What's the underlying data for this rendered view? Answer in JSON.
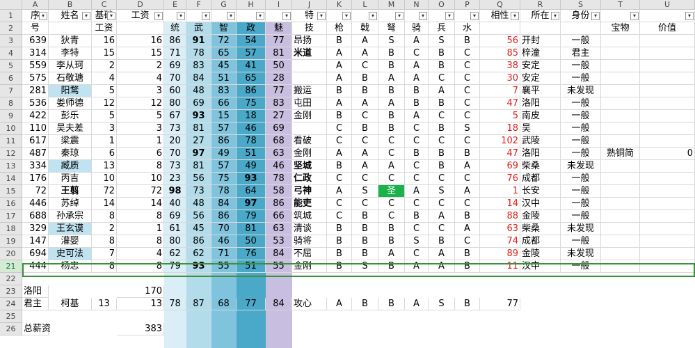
{
  "columns": [
    "A",
    "B",
    "C",
    "D",
    "E",
    "F",
    "G",
    "H",
    "I",
    "J",
    "K",
    "L",
    "M",
    "N",
    "O",
    "P",
    "Q",
    "R",
    "S",
    "T",
    "U"
  ],
  "selected_row": "21",
  "header_row1": [
    "序",
    "姓名",
    "基础",
    "工资",
    "",
    "",
    "",
    "",
    "",
    "特",
    "",
    "",
    "",
    "",
    "",
    "",
    "相性",
    "所在",
    "身份",
    "",
    ""
  ],
  "header_row2": [
    "号",
    "",
    "工资",
    "",
    "统",
    "武",
    "智",
    "政",
    "魅",
    "技",
    "枪",
    "戟",
    "弩",
    "骑",
    "兵",
    "水",
    "",
    "",
    "",
    "宝物",
    "价值"
  ],
  "rows": [
    {
      "n": "3",
      "a": "639",
      "b": "狄青",
      "c": "16",
      "d": "16",
      "e": "86",
      "f": "91",
      "g": "72",
      "h": "54",
      "i": "77",
      "j": "昂扬",
      "k": "B",
      "l": "A",
      "m": "S",
      "nn": "A",
      "o": "S",
      "p": "B",
      "q": "56",
      "r": "开封",
      "s": "一般",
      "t": "",
      "u": ""
    },
    {
      "n": "4",
      "a": "314",
      "b": "李特",
      "c": "15",
      "d": "15",
      "e": "71",
      "f": "78",
      "g": "65",
      "h": "57",
      "i": "81",
      "j": "米道",
      "k": "A",
      "l": "A",
      "m": "B",
      "nn": "C",
      "o": "B",
      "p": "C",
      "q": "85",
      "r": "梓潼",
      "s": "君主",
      "t": "",
      "u": ""
    },
    {
      "n": "5",
      "a": "559",
      "b": "李从珂",
      "c": "2",
      "d": "2",
      "e": "69",
      "f": "83",
      "g": "45",
      "h": "41",
      "i": "50",
      "j": "",
      "k": "A",
      "l": "C",
      "m": "B",
      "nn": "A",
      "o": "B",
      "p": "C",
      "q": "38",
      "r": "安定",
      "s": "一般",
      "t": "",
      "u": ""
    },
    {
      "n": "6",
      "a": "575",
      "b": "石敬瑭",
      "c": "4",
      "d": "4",
      "e": "70",
      "f": "84",
      "g": "51",
      "h": "65",
      "i": "28",
      "j": "",
      "k": "A",
      "l": "B",
      "m": "A",
      "nn": "A",
      "o": "C",
      "p": "C",
      "q": "30",
      "r": "安定",
      "s": "一般",
      "t": "",
      "u": ""
    },
    {
      "n": "7",
      "a": "281",
      "b": "阳鹜",
      "c": "5",
      "d": "3",
      "e": "60",
      "f": "48",
      "g": "83",
      "h": "86",
      "i": "77",
      "j": "搬运",
      "k": "B",
      "l": "B",
      "m": "B",
      "nn": "B",
      "o": "A",
      "p": "C",
      "q": "7",
      "r": "襄平",
      "s": "未发现",
      "t": "",
      "u": ""
    },
    {
      "n": "8",
      "a": "536",
      "b": "娄师德",
      "c": "12",
      "d": "12",
      "e": "80",
      "f": "69",
      "g": "66",
      "h": "75",
      "i": "83",
      "j": "屯田",
      "k": "A",
      "l": "A",
      "m": "A",
      "nn": "B",
      "o": "B",
      "p": "C",
      "q": "47",
      "r": "洛阳",
      "s": "一般",
      "t": "",
      "u": ""
    },
    {
      "n": "9",
      "a": "422",
      "b": "彭乐",
      "c": "5",
      "d": "5",
      "e": "67",
      "f": "93",
      "g": "15",
      "h": "18",
      "i": "27",
      "j": "金刚",
      "k": "B",
      "l": "C",
      "m": "B",
      "nn": "A",
      "o": "C",
      "p": "C",
      "q": "5",
      "r": "南皮",
      "s": "一般",
      "t": "",
      "u": ""
    },
    {
      "n": "10",
      "a": "110",
      "b": "吴夫差",
      "c": "3",
      "d": "3",
      "e": "73",
      "f": "81",
      "g": "57",
      "h": "46",
      "i": "69",
      "j": "",
      "k": "C",
      "l": "B",
      "m": "B",
      "nn": "C",
      "o": "B",
      "p": "S",
      "q": "18",
      "r": "吴",
      "s": "一般",
      "t": "",
      "u": ""
    },
    {
      "n": "11",
      "a": "617",
      "b": "梁震",
      "c": "1",
      "d": "1",
      "e": "20",
      "f": "27",
      "g": "86",
      "h": "78",
      "i": "68",
      "j": "看破",
      "k": "C",
      "l": "C",
      "m": "C",
      "nn": "C",
      "o": "C",
      "p": "C",
      "q": "102",
      "r": "武陵",
      "s": "一般",
      "t": "",
      "u": ""
    },
    {
      "n": "12",
      "a": "487",
      "b": "秦琼",
      "c": "6",
      "d": "6",
      "e": "70",
      "f": "97",
      "g": "49",
      "h": "51",
      "i": "63",
      "j": "金刚",
      "k": "A",
      "l": "A",
      "m": "C",
      "nn": "B",
      "o": "B",
      "p": "B",
      "q": "47",
      "r": "洛阳",
      "s": "一般",
      "t": "熟铜简",
      "u": "0"
    },
    {
      "n": "13",
      "a": "334",
      "b": "臧质",
      "c": "13",
      "d": "8",
      "e": "73",
      "f": "81",
      "g": "57",
      "h": "49",
      "i": "46",
      "j": "坚城",
      "k": "B",
      "l": "A",
      "m": "A",
      "nn": "C",
      "o": "B",
      "p": "A",
      "q": "69",
      "r": "柴桑",
      "s": "未发现",
      "t": "",
      "u": ""
    },
    {
      "n": "14",
      "a": "176",
      "b": "丙吉",
      "c": "10",
      "d": "10",
      "e": "23",
      "f": "56",
      "g": "75",
      "h": "93",
      "i": "78",
      "j": "仁政",
      "k": "C",
      "l": "C",
      "m": "C",
      "nn": "C",
      "o": "C",
      "p": "C",
      "q": "76",
      "r": "成都",
      "s": "一般",
      "t": "",
      "u": ""
    },
    {
      "n": "15",
      "a": "72",
      "b": "王翦",
      "c": "72",
      "d": "72",
      "e": "98",
      "f": "73",
      "g": "78",
      "h": "64",
      "i": "58",
      "j": "弓神",
      "k": "A",
      "l": "S",
      "m": "圣",
      "nn": "A",
      "o": "S",
      "p": "A",
      "q": "1",
      "r": "长安",
      "s": "一般",
      "t": "",
      "u": ""
    },
    {
      "n": "16",
      "a": "446",
      "b": "苏绰",
      "c": "14",
      "d": "14",
      "e": "40",
      "f": "48",
      "g": "84",
      "h": "97",
      "i": "86",
      "j": "能吏",
      "k": "C",
      "l": "C",
      "m": "C",
      "nn": "C",
      "o": "C",
      "p": "C",
      "q": "14",
      "r": "汉中",
      "s": "一般",
      "t": "",
      "u": ""
    },
    {
      "n": "17",
      "a": "688",
      "b": "孙承宗",
      "c": "8",
      "d": "8",
      "e": "69",
      "f": "56",
      "g": "86",
      "h": "79",
      "i": "66",
      "j": "筑城",
      "k": "C",
      "l": "B",
      "m": "C",
      "nn": "B",
      "o": "A",
      "p": "B",
      "q": "88",
      "r": "金陵",
      "s": "一般",
      "t": "",
      "u": ""
    },
    {
      "n": "18",
      "a": "329",
      "b": "王玄谟",
      "c": "2",
      "d": "1",
      "e": "61",
      "f": "45",
      "g": "70",
      "h": "81",
      "i": "63",
      "j": "清谈",
      "k": "B",
      "l": "B",
      "m": "B",
      "nn": "C",
      "o": "C",
      "p": "A",
      "q": "63",
      "r": "柴桑",
      "s": "未发现",
      "t": "",
      "u": ""
    },
    {
      "n": "19",
      "a": "147",
      "b": "灌婴",
      "c": "8",
      "d": "8",
      "e": "80",
      "f": "86",
      "g": "46",
      "h": "50",
      "i": "53",
      "j": "骑将",
      "k": "B",
      "l": "B",
      "m": "B",
      "nn": "S",
      "o": "B",
      "p": "C",
      "q": "74",
      "r": "成都",
      "s": "一般",
      "t": "",
      "u": ""
    },
    {
      "n": "20",
      "a": "694",
      "b": "史可法",
      "c": "7",
      "d": "4",
      "e": "62",
      "f": "62",
      "g": "71",
      "h": "76",
      "i": "84",
      "j": "不屈",
      "k": "B",
      "l": "B",
      "m": "A",
      "nn": "C",
      "o": "A",
      "p": "B",
      "q": "89",
      "r": "金陵",
      "s": "未发现",
      "t": "",
      "u": ""
    },
    {
      "n": "21",
      "a": "444",
      "b": "杨忠",
      "c": "8",
      "d": "8",
      "e": "79",
      "f": "93",
      "g": "55",
      "h": "51",
      "i": "55",
      "j": "金刚",
      "k": "B",
      "l": "S",
      "m": "B",
      "nn": "A",
      "o": "A",
      "p": "B",
      "q": "11",
      "r": "汉中",
      "s": "一般",
      "t": "",
      "u": ""
    }
  ],
  "row22": {
    "n": "22"
  },
  "row23": {
    "n": "23",
    "a": "洛阳",
    "d": "170"
  },
  "row24": {
    "n": "24",
    "a": "君主",
    "b": "柯基",
    "c": "13",
    "d": "13",
    "e": "78",
    "f": "87",
    "g": "68",
    "h": "77",
    "i": "84",
    "j": "攻心",
    "k": "A",
    "l": "B",
    "m": "B",
    "nn": "A",
    "o": "S",
    "p": "B",
    "q": "77"
  },
  "row25": {
    "n": "25"
  },
  "row26": {
    "n": "26",
    "a": "总薪资",
    "d": "383"
  },
  "colors": {
    "accent": "#217346",
    "sel_border": "#39913a",
    "red": "#e0201b",
    "shengfill": "#1bb24b",
    "E": "#d9eef6",
    "F": "#b3dcea",
    "G": "#7fc3dd",
    "H": "#4aa8c8",
    "I": "#c8bedf",
    "B_highlight": "#bfe3f0"
  },
  "icons": {
    "filter": "filter-dropdown-icon"
  }
}
